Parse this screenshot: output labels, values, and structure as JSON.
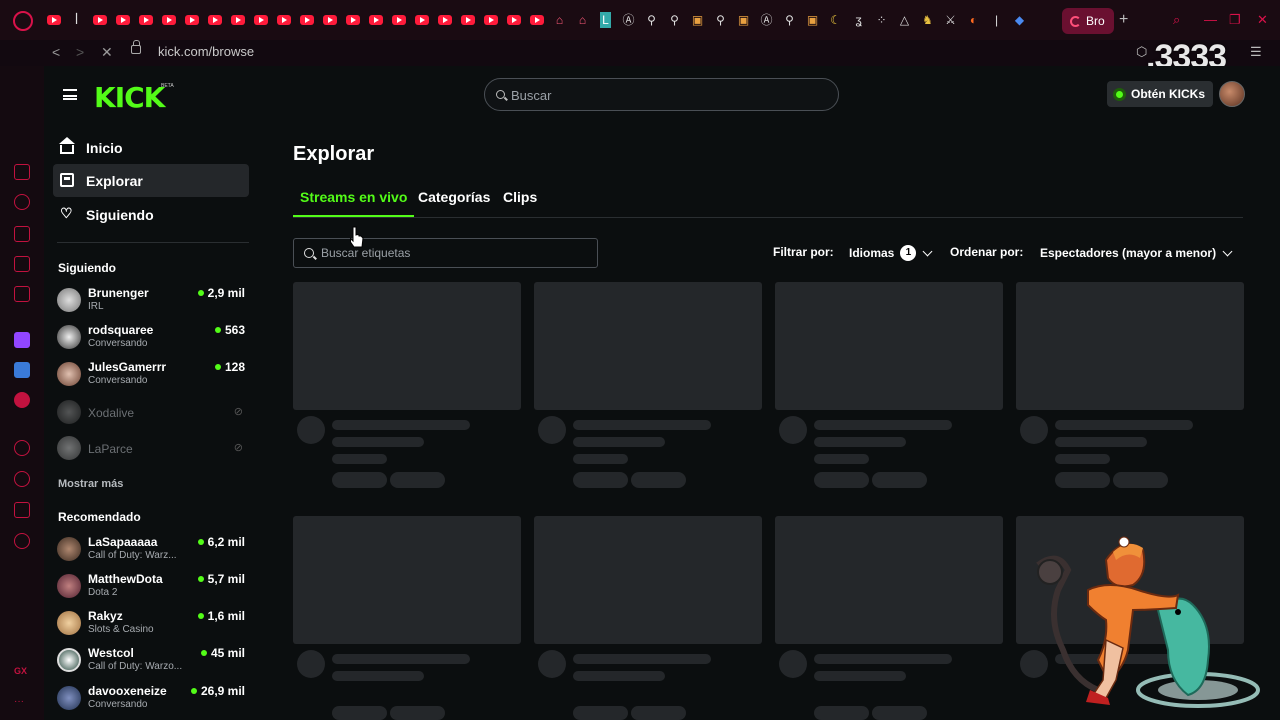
{
  "browser": {
    "url": "kick.com/browse",
    "active_tab_label": "Bro",
    "overlay_number": ".3333"
  },
  "header": {
    "logo": "KICK",
    "logo_badge": "BETA",
    "search_placeholder": "Buscar",
    "kicks_button": "Obtén KICKs"
  },
  "sidebar": {
    "nav": [
      {
        "label": "Inicio",
        "icon": "home-icon"
      },
      {
        "label": "Explorar",
        "icon": "browse-icon"
      },
      {
        "label": "Siguiendo",
        "icon": "heart-icon"
      }
    ],
    "following_heading": "Siguiendo",
    "following": [
      {
        "name": "Brunenger",
        "sub": "IRL",
        "viewers": "2,9 mil",
        "live": true
      },
      {
        "name": "rodsquaree",
        "sub": "Conversando",
        "viewers": "563",
        "live": true
      },
      {
        "name": "JulesGamerrr",
        "sub": "Conversando",
        "viewers": "128",
        "live": true
      },
      {
        "name": "Xodalive",
        "live": false
      },
      {
        "name": "LaParce",
        "live": false
      }
    ],
    "show_more": "Mostrar más",
    "recommended_heading": "Recomendado",
    "recommended": [
      {
        "name": "LaSapaaaaa",
        "sub": "Call of Duty: Warz...",
        "viewers": "6,2 mil"
      },
      {
        "name": "MatthewDota",
        "sub": "Dota 2",
        "viewers": "5,7 mil"
      },
      {
        "name": "Rakyz",
        "sub": "Slots & Casino",
        "viewers": "1,6 mil"
      },
      {
        "name": "Westcol",
        "sub": "Call of Duty: Warzo...",
        "viewers": "45 mil"
      },
      {
        "name": "davooxeneize",
        "sub": "Conversando",
        "viewers": "26,9 mil"
      }
    ]
  },
  "main": {
    "title": "Explorar",
    "tabs": [
      "Streams en vivo",
      "Categorías",
      "Clips"
    ],
    "tag_search_placeholder": "Buscar etiquetas",
    "filter_label": "Filtrar por:",
    "filter_value": "Idiomas",
    "filter_count": "1",
    "sort_label": "Ordenar por:",
    "sort_value": "Espectadores (mayor a menor)"
  },
  "colors": {
    "accent": "#53fc18",
    "background": "#0b0e0f",
    "skeleton": "#24272a",
    "opera_red": "#d9124a"
  }
}
